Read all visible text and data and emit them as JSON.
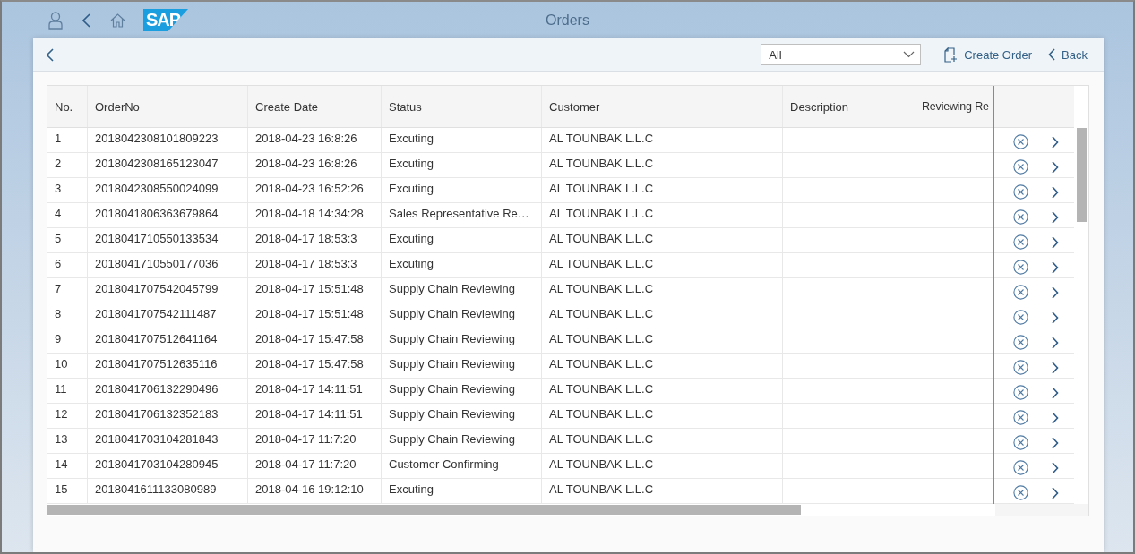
{
  "shell": {
    "logo": "SAP",
    "title": "Orders"
  },
  "toolbar": {
    "filter": {
      "value": "All"
    },
    "buttons": [
      {
        "kind": "create",
        "label": "Create Order"
      },
      {
        "kind": "back",
        "label": "Back"
      }
    ]
  },
  "table": {
    "columns": [
      "No.",
      "OrderNo",
      "Create Date",
      "Status",
      "Customer",
      "Description",
      "Reviewing Re"
    ],
    "rows": [
      {
        "no": "1",
        "order_no": "2018042308101809223",
        "create_date": "2018-04-23 16:8:26",
        "status": "Excuting",
        "customer": "AL TOUNBAK L.L.C"
      },
      {
        "no": "2",
        "order_no": "2018042308165123047",
        "create_date": "2018-04-23 16:8:26",
        "status": "Excuting",
        "customer": "AL TOUNBAK L.L.C"
      },
      {
        "no": "3",
        "order_no": "2018042308550024099",
        "create_date": "2018-04-23 16:52:26",
        "status": "Excuting",
        "customer": "AL TOUNBAK L.L.C"
      },
      {
        "no": "4",
        "order_no": "2018041806363679864",
        "create_date": "2018-04-18 14:34:28",
        "status": "Sales Representative Re…",
        "customer": "AL TOUNBAK L.L.C"
      },
      {
        "no": "5",
        "order_no": "2018041710550133534",
        "create_date": "2018-04-17 18:53:3",
        "status": "Excuting",
        "customer": "AL TOUNBAK L.L.C"
      },
      {
        "no": "6",
        "order_no": "2018041710550177036",
        "create_date": "2018-04-17 18:53:3",
        "status": "Excuting",
        "customer": "AL TOUNBAK L.L.C"
      },
      {
        "no": "7",
        "order_no": "2018041707542045799",
        "create_date": "2018-04-17 15:51:48",
        "status": "Supply Chain Reviewing",
        "customer": "AL TOUNBAK L.L.C"
      },
      {
        "no": "8",
        "order_no": "2018041707542111487",
        "create_date": "2018-04-17 15:51:48",
        "status": "Supply Chain Reviewing",
        "customer": "AL TOUNBAK L.L.C"
      },
      {
        "no": "9",
        "order_no": "2018041707512641164",
        "create_date": "2018-04-17 15:47:58",
        "status": "Supply Chain Reviewing",
        "customer": "AL TOUNBAK L.L.C"
      },
      {
        "no": "10",
        "order_no": "2018041707512635116",
        "create_date": "2018-04-17 15:47:58",
        "status": "Supply Chain Reviewing",
        "customer": "AL TOUNBAK L.L.C"
      },
      {
        "no": "11",
        "order_no": "2018041706132290496",
        "create_date": "2018-04-17 14:11:51",
        "status": "Supply Chain Reviewing",
        "customer": "AL TOUNBAK L.L.C"
      },
      {
        "no": "12",
        "order_no": "2018041706132352183",
        "create_date": "2018-04-17 14:11:51",
        "status": "Supply Chain Reviewing",
        "customer": "AL TOUNBAK L.L.C"
      },
      {
        "no": "13",
        "order_no": "2018041703104281843",
        "create_date": "2018-04-17 11:7:20",
        "status": "Supply Chain Reviewing",
        "customer": "AL TOUNBAK L.L.C"
      },
      {
        "no": "14",
        "order_no": "2018041703104280945",
        "create_date": "2018-04-17 11:7:20",
        "status": "Customer Confirming",
        "customer": "AL TOUNBAK L.L.C"
      },
      {
        "no": "15",
        "order_no": "2018041611133080989",
        "create_date": "2018-04-16 19:12:10",
        "status": "Excuting",
        "customer": "AL TOUNBAK L.L.C"
      }
    ]
  }
}
